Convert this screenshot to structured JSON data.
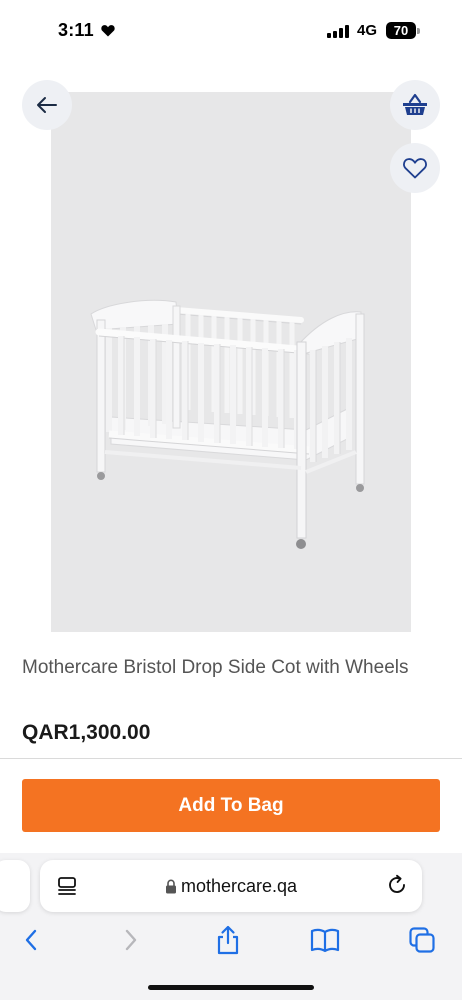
{
  "status_bar": {
    "time": "3:11",
    "network": "4G",
    "battery": "70"
  },
  "product": {
    "title": "Mothercare Bristol Drop Side Cot with Wheels",
    "price": "QAR1,300.00",
    "image_icon": "crib-image"
  },
  "actions": {
    "add_to_bag_label": "Add To Bag"
  },
  "browser": {
    "url": "mothercare.qa"
  },
  "colors": {
    "accent": "#f47322",
    "icon_blue": "#1f3f8f",
    "image_bg": "#e7e7e8",
    "ios_blue": "#1f6fe5"
  },
  "icons": [
    "back-arrow-icon",
    "shopping-basket-icon",
    "heart-icon",
    "reader-icon",
    "lock-icon",
    "reload-icon",
    "chevron-left-icon",
    "chevron-right-icon",
    "share-icon",
    "bookmarks-icon",
    "tabs-icon"
  ]
}
